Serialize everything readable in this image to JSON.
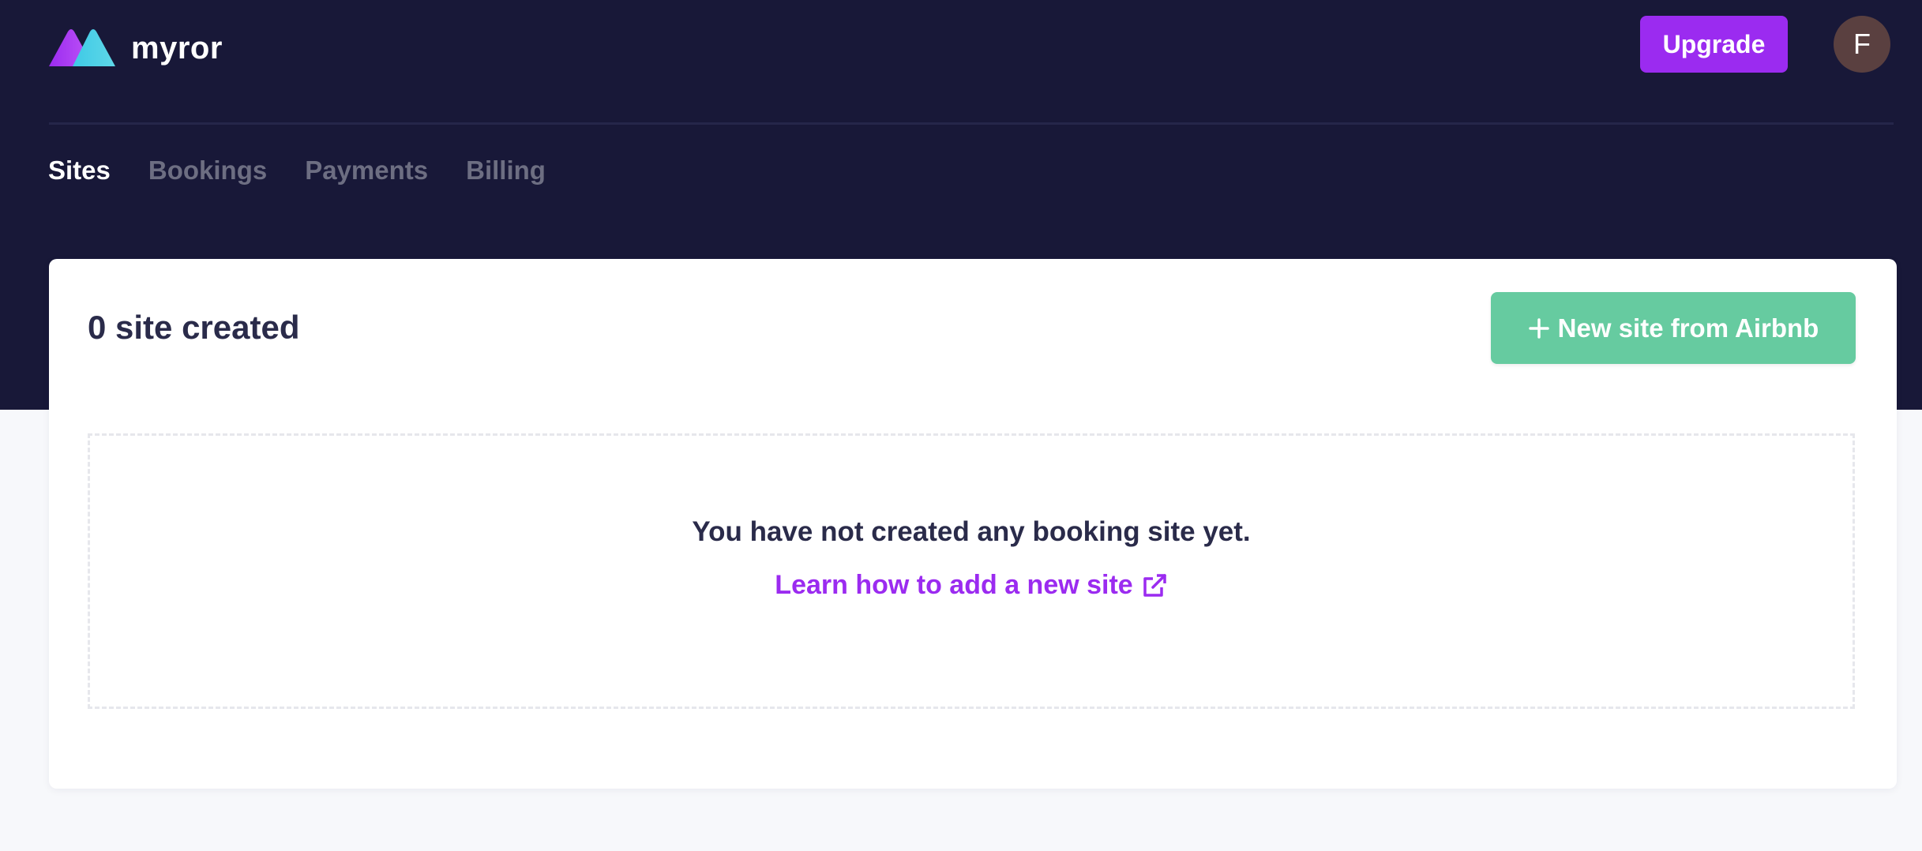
{
  "app": {
    "name": "myror"
  },
  "header": {
    "upgrade_label": "Upgrade",
    "avatar_initial": "F"
  },
  "nav": {
    "tabs": [
      {
        "label": "Sites",
        "active": true
      },
      {
        "label": "Bookings",
        "active": false
      },
      {
        "label": "Payments",
        "active": false
      },
      {
        "label": "Billing",
        "active": false
      }
    ]
  },
  "sites": {
    "title": "0 site created",
    "new_site_label": "New site from Airbnb",
    "empty_message": "You have not created any booking site yet.",
    "learn_link_label": "Learn how to add a new site"
  },
  "colors": {
    "header_bg": "#181838",
    "accent_purple": "#9b2bf0",
    "button_green": "#66cba0",
    "page_bg": "#f7f8fb",
    "text_dark": "#2a2b4a"
  },
  "icons": {
    "logo": "myror-logo",
    "plus": "plus-icon",
    "external_link": "external-link-icon"
  }
}
